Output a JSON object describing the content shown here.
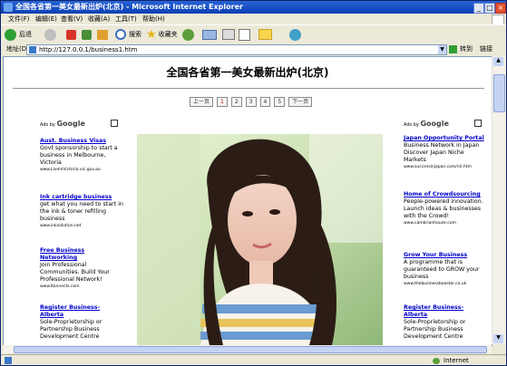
{
  "window": {
    "title": "全国各省第一美女最新出炉(北京) - Microsoft Internet Explorer",
    "minimize": "_",
    "maximize": "□",
    "close": "×"
  },
  "menu": [
    "文件(F)",
    "编辑(E)",
    "查看(V)",
    "收藏(A)",
    "工具(T)",
    "帮助(H)"
  ],
  "toolbar": {
    "back": "后退",
    "search": "搜索",
    "favorites": "收藏夹"
  },
  "address": {
    "label": "地址(D)",
    "url": "http://127.0.0.1/business1.htm",
    "go": "转到",
    "links": "链接"
  },
  "page": {
    "title": "全国各省第一美女最新出炉(北京)",
    "pager": {
      "prev": "上一页",
      "pages": [
        "1",
        "2",
        "3",
        "4",
        "5"
      ],
      "current": "1",
      "next": "下一页"
    },
    "ads_by": "Ads by",
    "google": "Google"
  },
  "left_ads": [
    {
      "title": "Aust. Business Visas",
      "desc": "Govt sponsorship to start a business in Melbourne, Victoria",
      "url": "www.LiveInVictoria.vic.gov.au"
    },
    {
      "title": "Ink cartridge business",
      "desc": "get what you need to start in the ink & toner refilling business",
      "url": "www.inksolution.net"
    },
    {
      "title": "Free Business Networking",
      "desc": "Join Professional Communities. Build Your Professional Network!",
      "url": "www.Konnects.com"
    },
    {
      "title": "Register Business-Alberta",
      "desc": "Sole-Proprietorship or Partnership Business Development Centre",
      "url": ""
    }
  ],
  "right_ads": [
    {
      "title": "Japan Opportunity Portal",
      "desc": "Business Network in Japan Discover Japan Niche Markets",
      "url": "www.successinjapan.com/nl/.htm"
    },
    {
      "title": "Home of Crowdsourcing",
      "desc": "People-powered innovation. Launch ideas & businesses with the Crowd!",
      "url": "www.cambrianhouse.com"
    },
    {
      "title": "Grow Your Business",
      "desc": "A programme that is guaranteed to GROW your business",
      "url": "www.thebusinessbooster.co.uk"
    },
    {
      "title": "Register Business-Alberta",
      "desc": "Sole-Proprietorship or Partnership Business Development Centre",
      "url": ""
    }
  ],
  "status": {
    "zone": "Internet"
  },
  "colors": {
    "titlebar": "#0b3fb4",
    "link": "#0000cc",
    "pager_active": "#cc0000"
  }
}
